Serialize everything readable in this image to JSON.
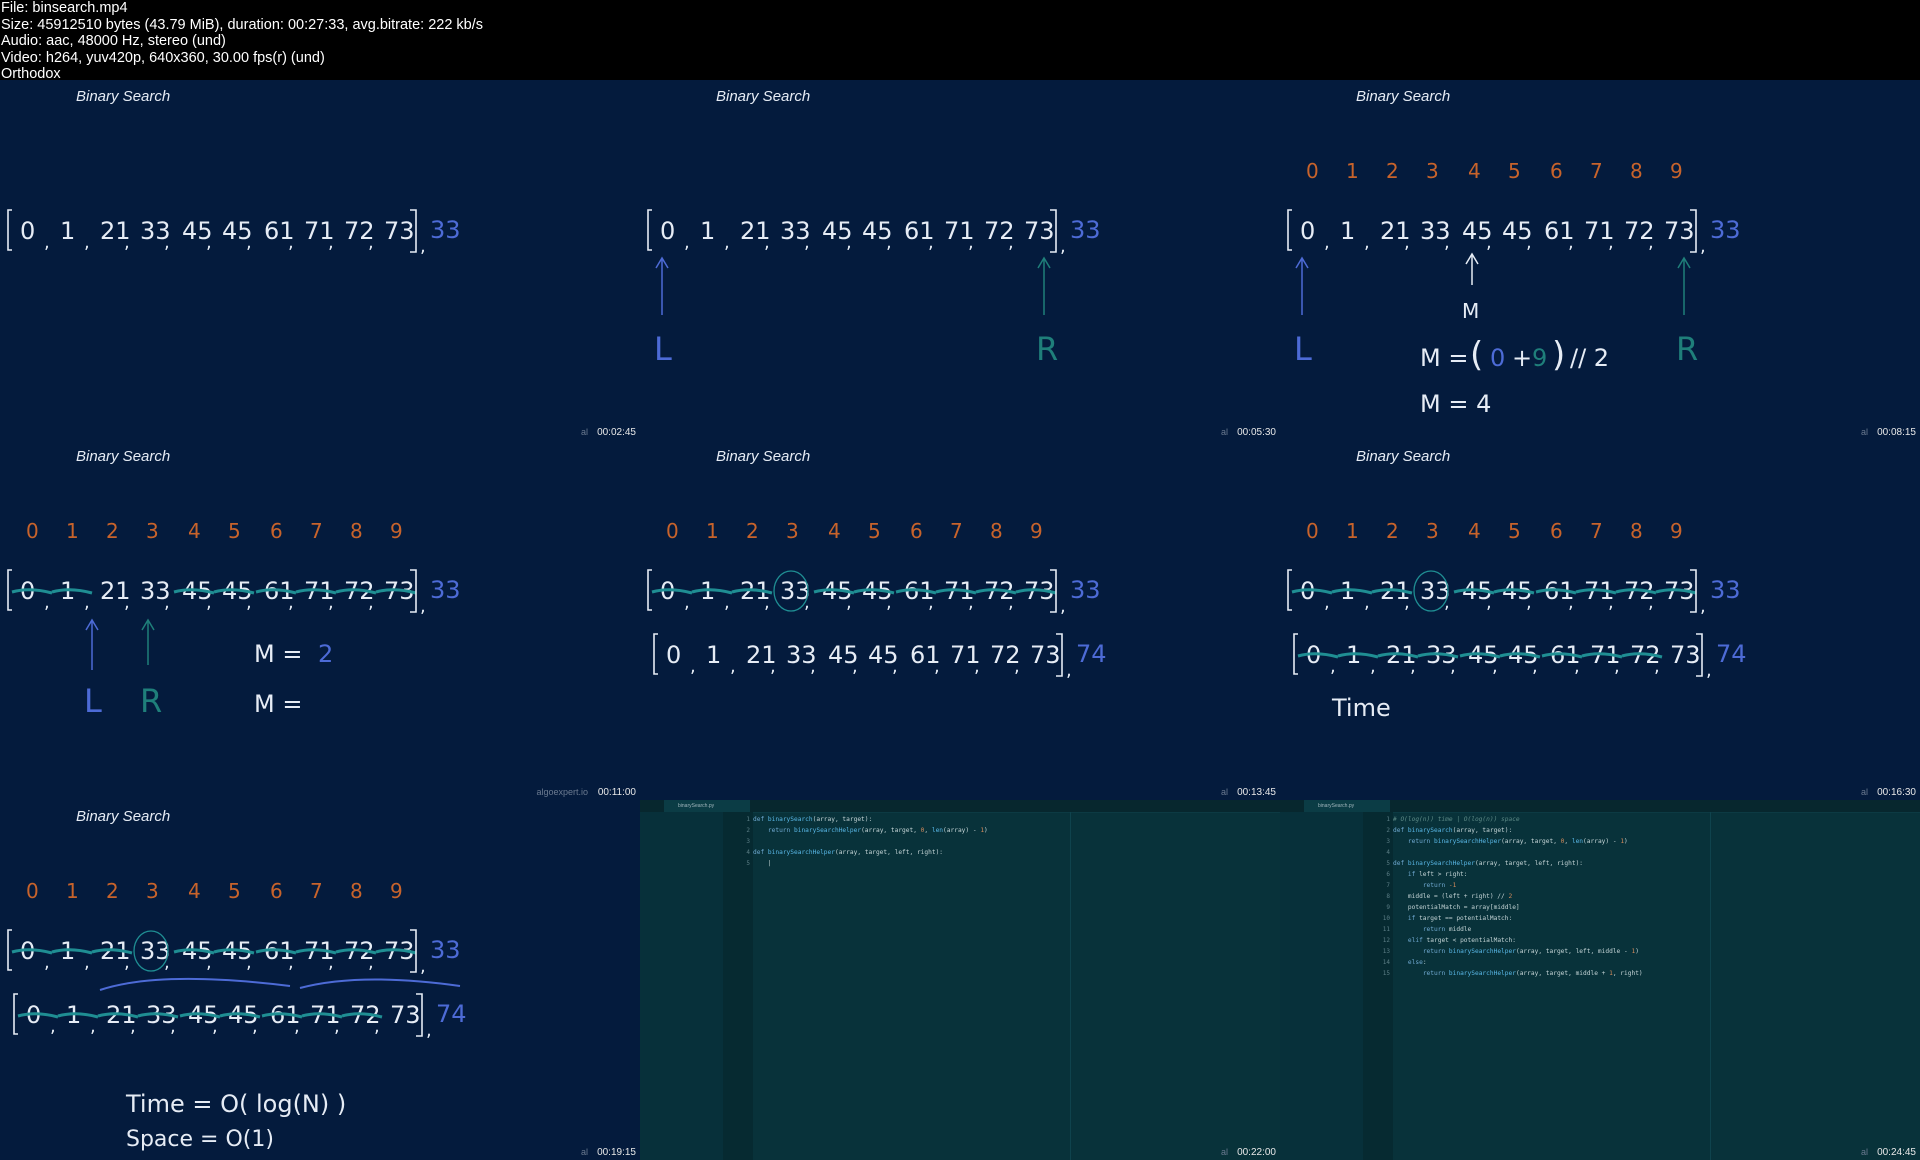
{
  "header": {
    "file": "File: binsearch.mp4",
    "size": "Size: 45912510 bytes (43.79 MiB), duration: 00:27:33, avg.bitrate: 222 kb/s",
    "audio": "Audio: aac, 48000 Hz, stereo (und)",
    "video": "Video: h264, yuv420p, 640x360, 30.00 fps(r) (und)",
    "extra": "Orthodox"
  },
  "slide_title": "Binary Search",
  "array_values": [
    "0",
    "1",
    "21",
    "33",
    "45",
    "45",
    "61",
    "71",
    "72",
    "73"
  ],
  "target": "33",
  "array2_values": [
    "0",
    "1",
    "21",
    "33",
    "45",
    "45",
    "61",
    "71",
    "72",
    "73"
  ],
  "target2": "74",
  "indices": [
    "0",
    "1",
    "2",
    "3",
    "4",
    "5",
    "6",
    "7",
    "8",
    "9"
  ],
  "labels": {
    "L": "L",
    "R": "R",
    "M": "M"
  },
  "formulas": {
    "m_calc_lhs": "M = ",
    "m_calc_expr_a": "0",
    "m_calc_expr_b": "9",
    "m_calc_rest": "// 2",
    "m_result": "M =  4",
    "m_eq2": "M =",
    "m_eq2_val": "2",
    "m_eq3": "M =",
    "time_word": "Time",
    "time_complexity": "Time = O( log(N) )",
    "space_complexity": "Space = O(1)"
  },
  "thumbnails": [
    {
      "timestamp": "00:02:45",
      "watermark": "al"
    },
    {
      "timestamp": "00:05:30",
      "watermark": "al"
    },
    {
      "timestamp": "00:08:15",
      "watermark": "al"
    },
    {
      "timestamp": "00:11:00",
      "watermark": "algoexpert.io"
    },
    {
      "timestamp": "00:13:45",
      "watermark": "al"
    },
    {
      "timestamp": "00:16:30",
      "watermark": "al"
    },
    {
      "timestamp": "00:19:15",
      "watermark": "al"
    },
    {
      "timestamp": "00:22:00",
      "watermark": "al"
    },
    {
      "timestamp": "00:24:45",
      "watermark": "al"
    }
  ],
  "editor1": {
    "tab": "binarySearch.py",
    "line_numbers": "1\n2\n3\n4\n5",
    "lines": [
      "def binarySearch(array, target):",
      "    return binarySearchHelper(array, target, 0, len(array) - 1)",
      "",
      "def binarySearchHelper(array, target, left, right):",
      "    |"
    ]
  },
  "editor2": {
    "tab": "binarySearch.py",
    "line_numbers": "1\n2\n3\n4\n5\n6\n7\n8\n9\n10\n11\n12\n13\n14\n15",
    "lines": [
      "# O(log(n)) time | O(log(n)) space",
      "def binarySearch(array, target):",
      "    return binarySearchHelper(array, target, 0, len(array) - 1)",
      "",
      "def binarySearchHelper(array, target, left, right):",
      "    if left > right:",
      "        return -1",
      "    middle = (left + right) // 2",
      "    potentialMatch = array[middle]",
      "    if target == potentialMatch:",
      "        return middle",
      "    elif target < potentialMatch:",
      "        return binarySearchHelper(array, target, left, middle - 1)",
      "    else:",
      "        return binarySearchHelper(array, target, middle + 1, right)"
    ]
  },
  "colors": {
    "slide_bg": "#041b3d",
    "index_orange": "#c8632b",
    "pointer_blue": "#4d6bd6",
    "pointer_teal": "#1f7f7a",
    "strike_teal": "#1f8e93",
    "text_white": "#e6ecf5"
  }
}
